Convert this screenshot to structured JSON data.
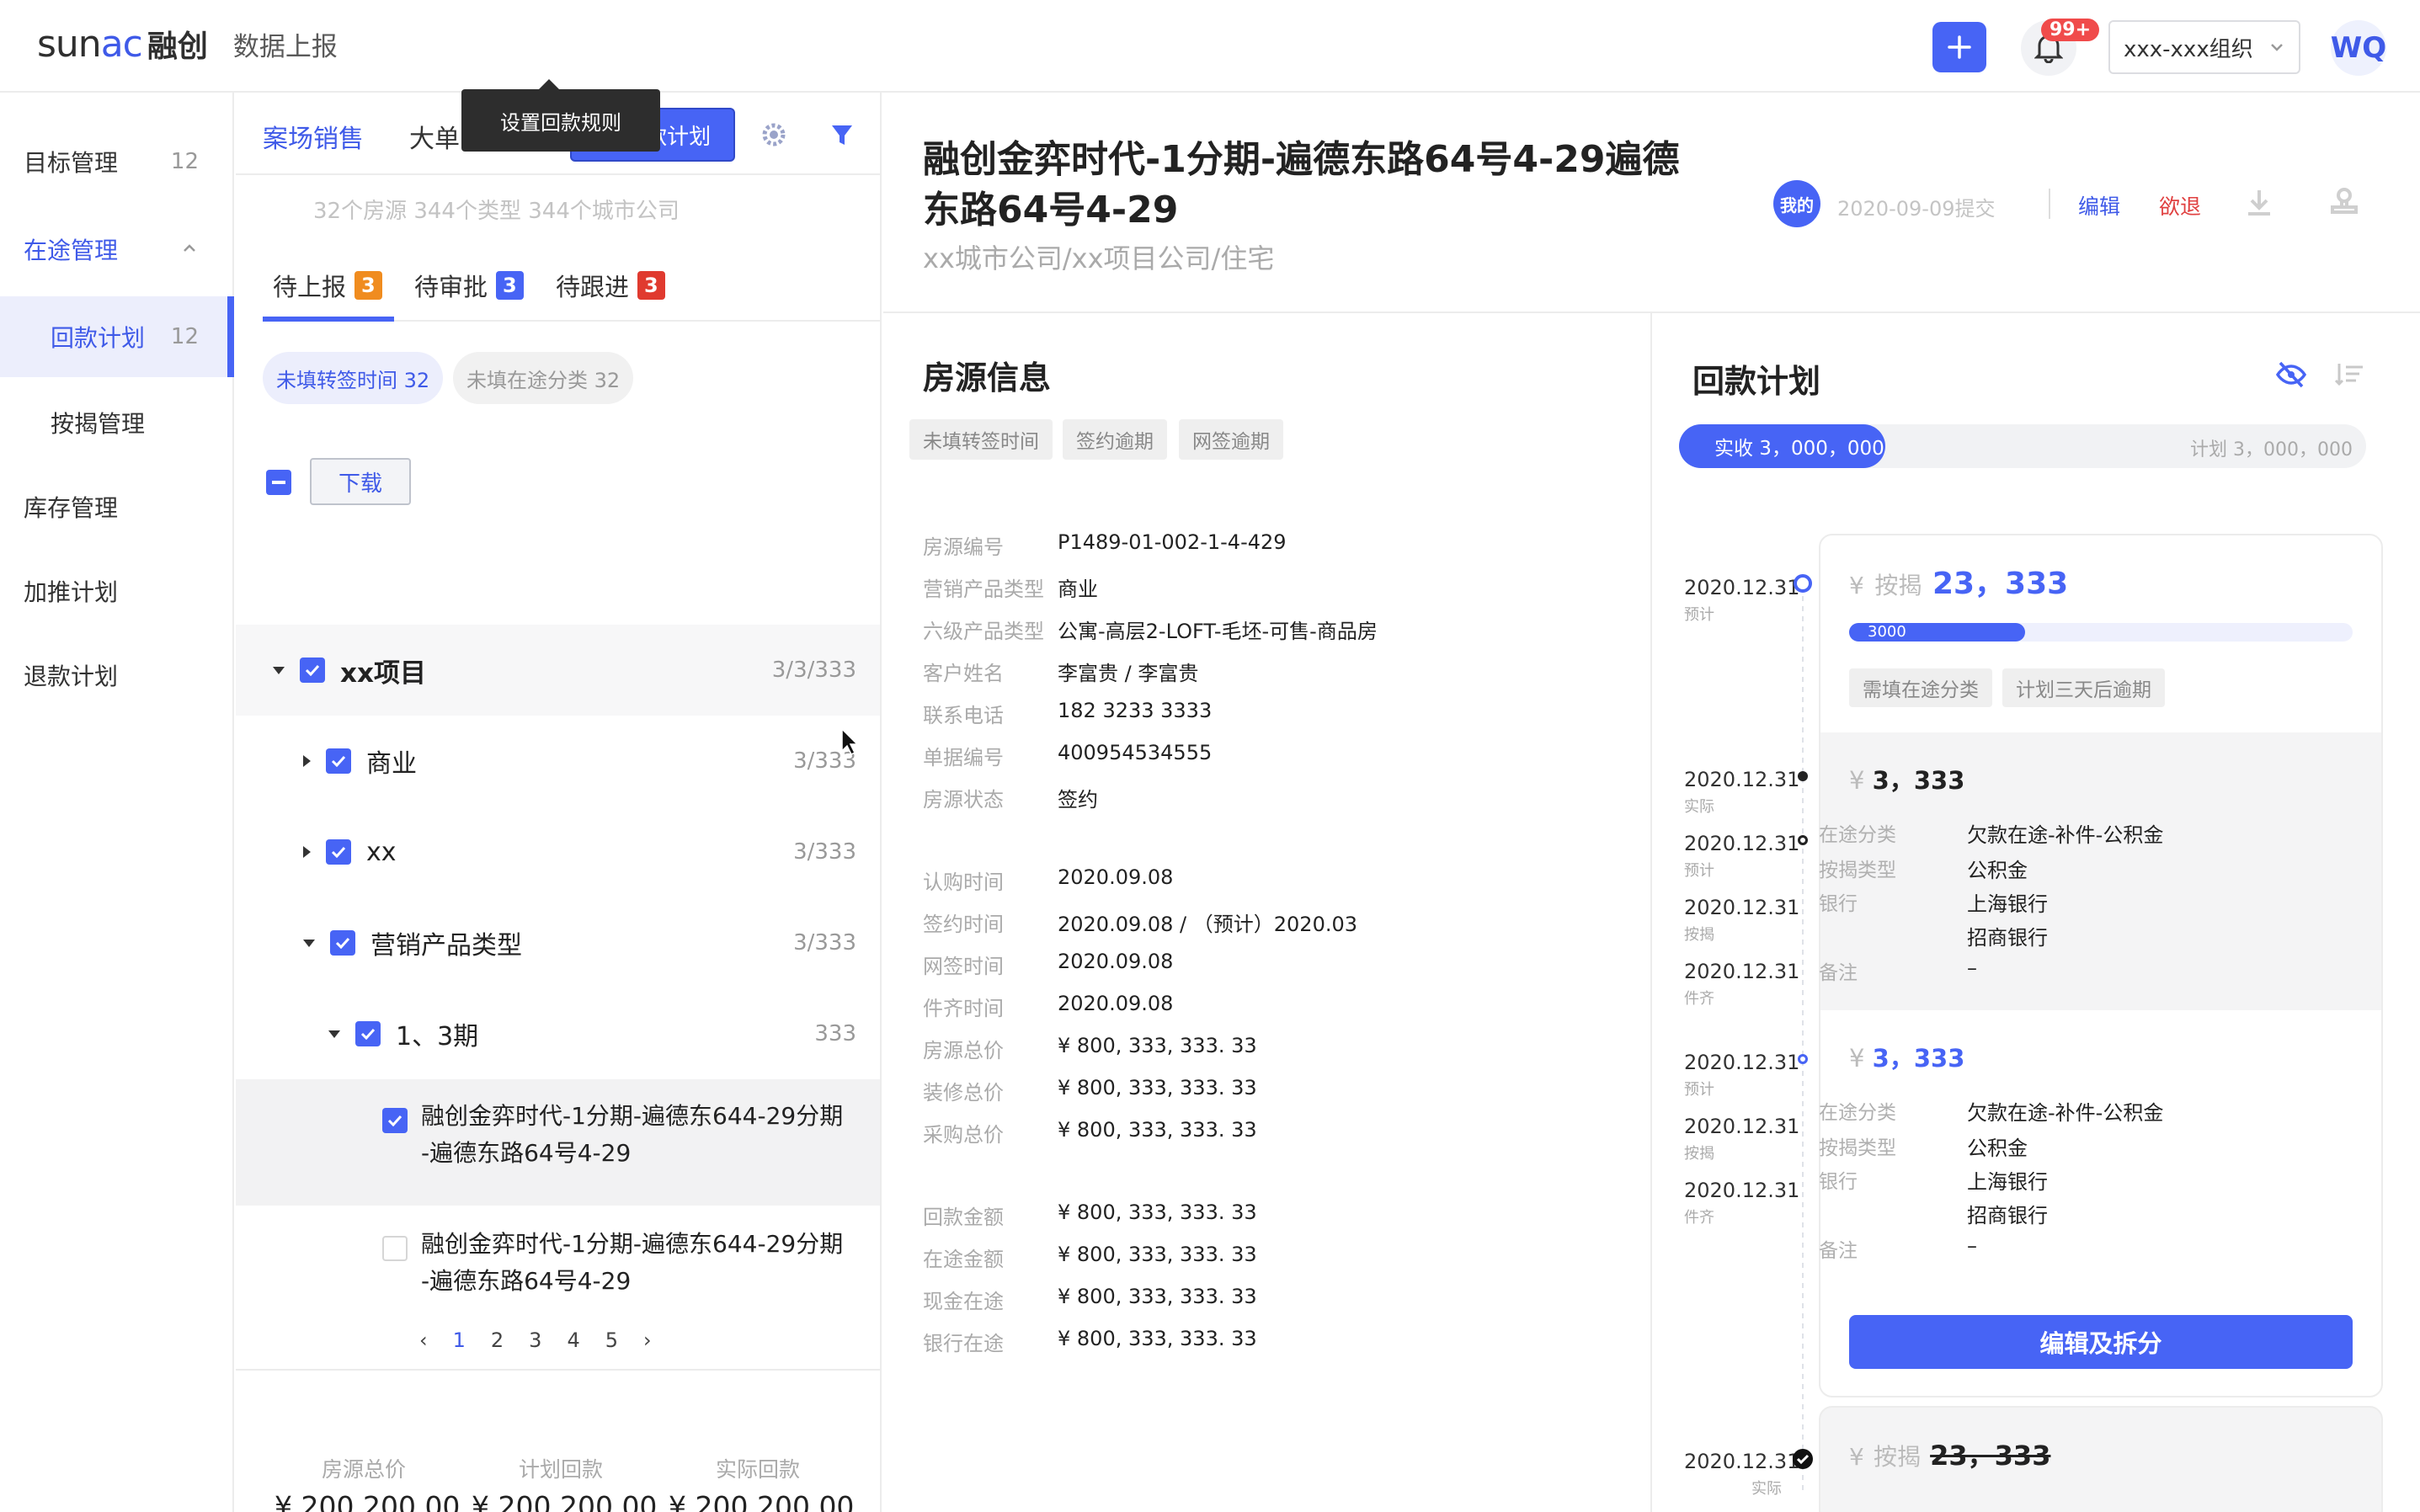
{
  "header": {
    "logo_text": "sunac",
    "logo_cn": "融创",
    "app_title": "数据上报",
    "notification_badge": "99+",
    "org_select": "xxx-xxx组织",
    "user_initials": "WQ"
  },
  "nav": {
    "items": [
      {
        "label": "目标管理",
        "count": "12"
      },
      {
        "label": "在途管理"
      },
      {
        "label": "回款计划",
        "count": "12"
      },
      {
        "label": "按揭管理"
      },
      {
        "label": "库存管理"
      },
      {
        "label": "加推计划"
      },
      {
        "label": "退款计划"
      }
    ]
  },
  "list": {
    "tabs": [
      "案场销售",
      "大单"
    ],
    "plan_button": "＋ 回款计划",
    "tooltip": "设置回款规则",
    "stats": "32个房源  344个类型  344个城市公司",
    "subtabs": [
      {
        "label": "待上报",
        "count": "3",
        "color": "#f08c1f"
      },
      {
        "label": "待审批",
        "count": "3",
        "color": "#4764f5"
      },
      {
        "label": "待跟进",
        "count": "3",
        "color": "#e03a2f"
      }
    ],
    "chips": [
      "未填转签时间 32",
      "未填在途分类 32"
    ],
    "download": "下载",
    "tree": [
      {
        "label": "xx项目",
        "num": "3/3/333"
      },
      {
        "label": "商业",
        "num": "3/333"
      },
      {
        "label": "xx",
        "num": "3/333"
      },
      {
        "label": "营销产品类型",
        "num": "3/333"
      },
      {
        "label": "1、3期",
        "num": "333"
      }
    ],
    "leaves": [
      {
        "line1": "融创金弈时代-1分期-遍德东644-29分期",
        "line2": "-遍德东路64号4-29"
      },
      {
        "line1": "融创金弈时代-1分期-遍德东644-29分期",
        "line2": "-遍德东路64号4-29"
      }
    ],
    "pages": [
      "1",
      "2",
      "3",
      "4",
      "5"
    ],
    "summary": [
      {
        "label": "房源总价",
        "value": "¥ 200,200,00"
      },
      {
        "label": "计划回款",
        "value": "¥ 200,200,00"
      },
      {
        "label": "实际回款",
        "value": "¥ 200,200,00"
      }
    ]
  },
  "detail": {
    "title_line1": "融创金弈时代-1分期-遍德东路64号4-29遍德",
    "title_line2": "东路64号4-29",
    "subtitle": "xx城市公司/xx项目公司/住宅",
    "mine_badge": "我的",
    "submit_date": "2020-09-09提交",
    "edit": "编辑",
    "back": "欲退",
    "house": {
      "title": "房源信息",
      "tags": [
        "未填转签时间",
        "签约逾期",
        "网签逾期"
      ],
      "fields1": [
        {
          "label": "房源编号",
          "value": "P1489-01-002-1-4-429"
        },
        {
          "label": "营销产品类型",
          "value": "商业"
        },
        {
          "label": "六级产品类型",
          "value": "公寓-高层2-LOFT-毛坯-可售-商品房"
        },
        {
          "label": "客户姓名",
          "value": "李富贵 / 李富贵"
        },
        {
          "label": "联系电话",
          "value": "182 3233 3333"
        },
        {
          "label": "单据编号",
          "value": "400954534555"
        },
        {
          "label": "房源状态",
          "value": "签约"
        }
      ],
      "fields2": [
        {
          "label": "认购时间",
          "value": "2020.09.08"
        },
        {
          "label": "签约时间",
          "value": "2020.09.08 / （预计）2020.03"
        },
        {
          "label": "网签时间",
          "value": "2020.09.08"
        },
        {
          "label": "件齐时间",
          "value": "2020.09.08"
        },
        {
          "label": "房源总价",
          "value": "¥ 800, 333, 333. 33"
        },
        {
          "label": "装修总价",
          "value": "¥ 800, 333, 333. 33"
        },
        {
          "label": "采购总价",
          "value": "¥ 800, 333, 333. 33"
        }
      ],
      "fields3": [
        {
          "label": "回款金额",
          "value": "¥ 800, 333, 333. 33"
        },
        {
          "label": "在途金额",
          "value": "¥ 800, 333, 333. 33"
        },
        {
          "label": "现金在途",
          "value": "¥ 800, 333, 333. 33"
        },
        {
          "label": "银行在途",
          "value": "¥ 800, 333, 333. 33"
        }
      ]
    },
    "plan": {
      "title": "回款计划",
      "actual": "实收 3，000，000",
      "planned": "计划 3，000，000",
      "progress_fraction": 0.3,
      "timeline": [
        {
          "date": "2020.12.31",
          "kind": "预计"
        },
        {
          "date": "2020.12.31",
          "kind": "实际"
        },
        {
          "date": "2020.12.31",
          "kind": "预计"
        },
        {
          "date": "2020.12.31",
          "kind": "按揭"
        },
        {
          "date": "2020.12.31",
          "kind": "件齐"
        },
        {
          "date": "2020.12.31",
          "kind": "预计"
        },
        {
          "date": "2020.12.31",
          "kind": "按揭"
        },
        {
          "date": "2020.12.31",
          "kind": "件齐"
        },
        {
          "date": "2020.12.31",
          "kind": "实际"
        }
      ],
      "card1": {
        "yen": "¥",
        "kind": "按揭",
        "amount": "23，333",
        "mini_value": "3000",
        "mini_fraction": 0.35,
        "tags": [
          "需填在途分类",
          "计划三天后逾期"
        ]
      },
      "block1": {
        "amount": "3，333",
        "fields": [
          {
            "label": "在途分类",
            "value": "欠款在途-补件-公积金"
          },
          {
            "label": "按揭类型",
            "value": "公积金"
          },
          {
            "label": "银行",
            "value": "上海银行"
          },
          {
            "label": "",
            "value": "招商银行"
          },
          {
            "label": "备注",
            "value": "–"
          }
        ]
      },
      "block2": {
        "amount": "3，333",
        "fields": [
          {
            "label": "在途分类",
            "value": "欠款在途-补件-公积金"
          },
          {
            "label": "按揭类型",
            "value": "公积金"
          },
          {
            "label": "银行",
            "value": "上海银行"
          },
          {
            "label": "",
            "value": "招商银行"
          },
          {
            "label": "备注",
            "value": "–"
          }
        ]
      },
      "split_button": "编辑及拆分",
      "card2": {
        "yen": "¥",
        "kind": "按揭",
        "amount": "23，333"
      }
    }
  }
}
